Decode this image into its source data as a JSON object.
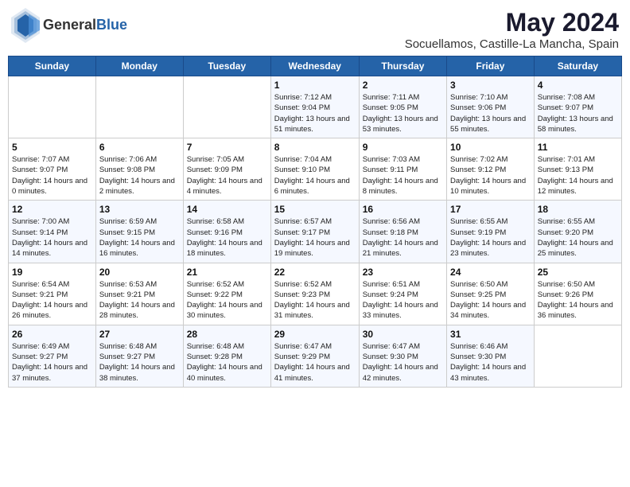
{
  "header": {
    "logo_general": "General",
    "logo_blue": "Blue",
    "month": "May 2024",
    "location": "Socuellamos, Castille-La Mancha, Spain"
  },
  "weekdays": [
    "Sunday",
    "Monday",
    "Tuesday",
    "Wednesday",
    "Thursday",
    "Friday",
    "Saturday"
  ],
  "weeks": [
    [
      {
        "day": "",
        "info": ""
      },
      {
        "day": "",
        "info": ""
      },
      {
        "day": "",
        "info": ""
      },
      {
        "day": "1",
        "info": "Sunrise: 7:12 AM\nSunset: 9:04 PM\nDaylight: 13 hours and 51 minutes."
      },
      {
        "day": "2",
        "info": "Sunrise: 7:11 AM\nSunset: 9:05 PM\nDaylight: 13 hours and 53 minutes."
      },
      {
        "day": "3",
        "info": "Sunrise: 7:10 AM\nSunset: 9:06 PM\nDaylight: 13 hours and 55 minutes."
      },
      {
        "day": "4",
        "info": "Sunrise: 7:08 AM\nSunset: 9:07 PM\nDaylight: 13 hours and 58 minutes."
      }
    ],
    [
      {
        "day": "5",
        "info": "Sunrise: 7:07 AM\nSunset: 9:07 PM\nDaylight: 14 hours and 0 minutes."
      },
      {
        "day": "6",
        "info": "Sunrise: 7:06 AM\nSunset: 9:08 PM\nDaylight: 14 hours and 2 minutes."
      },
      {
        "day": "7",
        "info": "Sunrise: 7:05 AM\nSunset: 9:09 PM\nDaylight: 14 hours and 4 minutes."
      },
      {
        "day": "8",
        "info": "Sunrise: 7:04 AM\nSunset: 9:10 PM\nDaylight: 14 hours and 6 minutes."
      },
      {
        "day": "9",
        "info": "Sunrise: 7:03 AM\nSunset: 9:11 PM\nDaylight: 14 hours and 8 minutes."
      },
      {
        "day": "10",
        "info": "Sunrise: 7:02 AM\nSunset: 9:12 PM\nDaylight: 14 hours and 10 minutes."
      },
      {
        "day": "11",
        "info": "Sunrise: 7:01 AM\nSunset: 9:13 PM\nDaylight: 14 hours and 12 minutes."
      }
    ],
    [
      {
        "day": "12",
        "info": "Sunrise: 7:00 AM\nSunset: 9:14 PM\nDaylight: 14 hours and 14 minutes."
      },
      {
        "day": "13",
        "info": "Sunrise: 6:59 AM\nSunset: 9:15 PM\nDaylight: 14 hours and 16 minutes."
      },
      {
        "day": "14",
        "info": "Sunrise: 6:58 AM\nSunset: 9:16 PM\nDaylight: 14 hours and 18 minutes."
      },
      {
        "day": "15",
        "info": "Sunrise: 6:57 AM\nSunset: 9:17 PM\nDaylight: 14 hours and 19 minutes."
      },
      {
        "day": "16",
        "info": "Sunrise: 6:56 AM\nSunset: 9:18 PM\nDaylight: 14 hours and 21 minutes."
      },
      {
        "day": "17",
        "info": "Sunrise: 6:55 AM\nSunset: 9:19 PM\nDaylight: 14 hours and 23 minutes."
      },
      {
        "day": "18",
        "info": "Sunrise: 6:55 AM\nSunset: 9:20 PM\nDaylight: 14 hours and 25 minutes."
      }
    ],
    [
      {
        "day": "19",
        "info": "Sunrise: 6:54 AM\nSunset: 9:21 PM\nDaylight: 14 hours and 26 minutes."
      },
      {
        "day": "20",
        "info": "Sunrise: 6:53 AM\nSunset: 9:21 PM\nDaylight: 14 hours and 28 minutes."
      },
      {
        "day": "21",
        "info": "Sunrise: 6:52 AM\nSunset: 9:22 PM\nDaylight: 14 hours and 30 minutes."
      },
      {
        "day": "22",
        "info": "Sunrise: 6:52 AM\nSunset: 9:23 PM\nDaylight: 14 hours and 31 minutes."
      },
      {
        "day": "23",
        "info": "Sunrise: 6:51 AM\nSunset: 9:24 PM\nDaylight: 14 hours and 33 minutes."
      },
      {
        "day": "24",
        "info": "Sunrise: 6:50 AM\nSunset: 9:25 PM\nDaylight: 14 hours and 34 minutes."
      },
      {
        "day": "25",
        "info": "Sunrise: 6:50 AM\nSunset: 9:26 PM\nDaylight: 14 hours and 36 minutes."
      }
    ],
    [
      {
        "day": "26",
        "info": "Sunrise: 6:49 AM\nSunset: 9:27 PM\nDaylight: 14 hours and 37 minutes."
      },
      {
        "day": "27",
        "info": "Sunrise: 6:48 AM\nSunset: 9:27 PM\nDaylight: 14 hours and 38 minutes."
      },
      {
        "day": "28",
        "info": "Sunrise: 6:48 AM\nSunset: 9:28 PM\nDaylight: 14 hours and 40 minutes."
      },
      {
        "day": "29",
        "info": "Sunrise: 6:47 AM\nSunset: 9:29 PM\nDaylight: 14 hours and 41 minutes."
      },
      {
        "day": "30",
        "info": "Sunrise: 6:47 AM\nSunset: 9:30 PM\nDaylight: 14 hours and 42 minutes."
      },
      {
        "day": "31",
        "info": "Sunrise: 6:46 AM\nSunset: 9:30 PM\nDaylight: 14 hours and 43 minutes."
      },
      {
        "day": "",
        "info": ""
      }
    ]
  ]
}
